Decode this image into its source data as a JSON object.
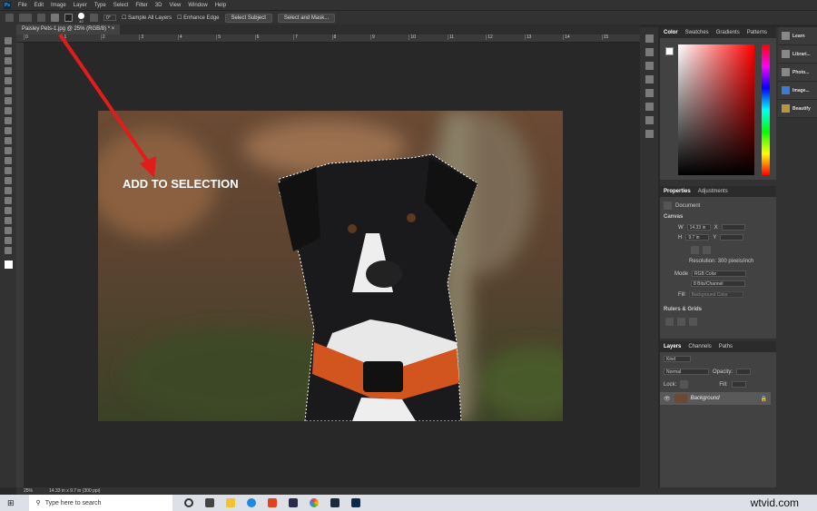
{
  "menu": [
    "File",
    "Edit",
    "Image",
    "Layer",
    "Type",
    "Select",
    "Filter",
    "3D",
    "View",
    "Window",
    "Help"
  ],
  "options": {
    "brush_size": "40",
    "angle": "0°",
    "sample_all_layers": "Sample All Layers",
    "enhance_edge": "Enhance Edge",
    "select_subject": "Select Subject",
    "select_and_mask": "Select and Mask..."
  },
  "document_tab": "Paisley Pets-1.jpg @ 25% (RGB/8) *",
  "ruler_ticks": [
    "0",
    "1",
    "2",
    "3",
    "4",
    "5",
    "6",
    "7",
    "8",
    "9",
    "10",
    "11",
    "12",
    "13",
    "14",
    "15"
  ],
  "annotation": "ADD TO SELECTION",
  "color_panel": {
    "tabs": [
      "Color",
      "Swatches",
      "Gradients",
      "Patterns"
    ],
    "accent": "#ff0000"
  },
  "properties": {
    "tabs": [
      "Properties",
      "Adjustments"
    ],
    "doc_label": "Document",
    "canvas": "Canvas",
    "w_label": "W",
    "w": "14.33 in",
    "h_label": "H",
    "h": "9.7 in",
    "x_label": "X",
    "y_label": "Y",
    "resolution": "Resolution: 300 pixels/inch",
    "mode_label": "Mode",
    "mode": "RGB Color",
    "depth": "8 Bits/Channel",
    "fill_label": "Fill",
    "fill": "Background Color",
    "rulers": "Rulers & Grids"
  },
  "layers": {
    "tabs": [
      "Layers",
      "Channels",
      "Paths"
    ],
    "kind": "Kind",
    "blend": "Normal",
    "opacity_label": "Opacity:",
    "lock_label": "Lock:",
    "fill_label": "Fill:",
    "layer_name": "Background"
  },
  "learn_panel": [
    "Learn",
    "Librari...",
    "Photo...",
    "Image...",
    "Beautify"
  ],
  "status": {
    "zoom": "25%",
    "doc_info": "14.33 in x 9.7 in (300 ppi)"
  },
  "taskbar": {
    "search_placeholder": "Type here to search",
    "watermark": "wtvid.com"
  }
}
